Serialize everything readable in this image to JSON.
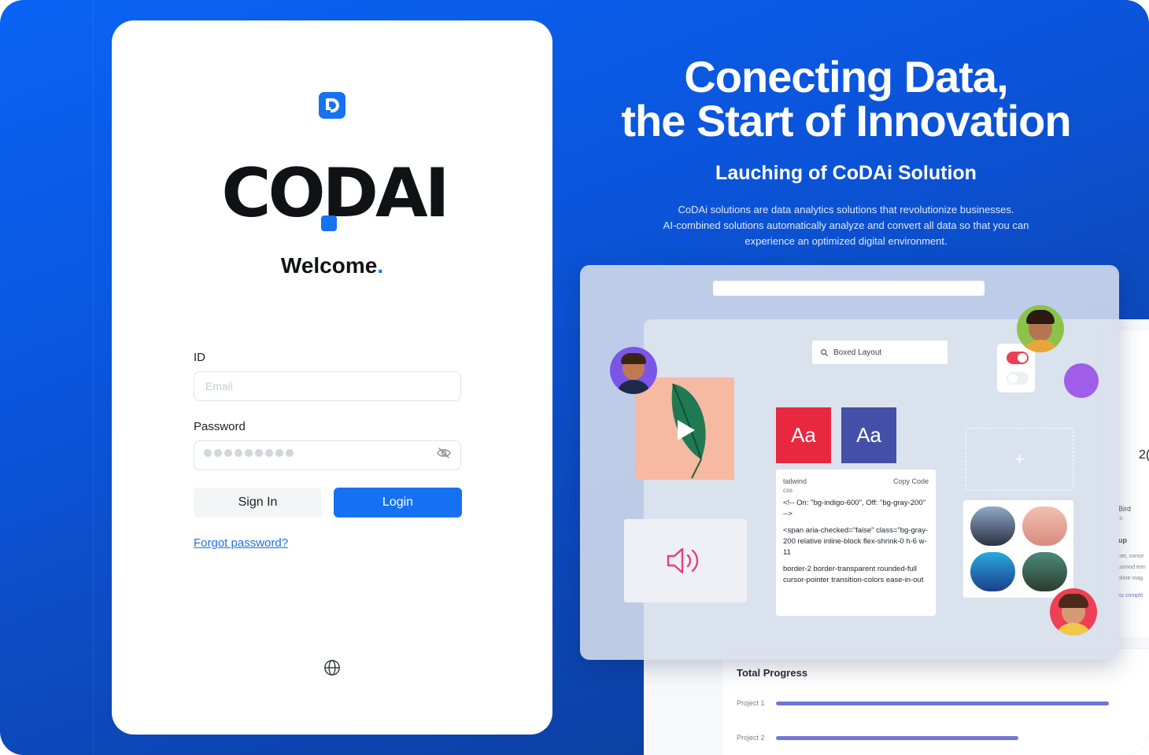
{
  "brand": {
    "wordmark": "CODAI",
    "primary_color": "#1673f0",
    "icon": "codai-logo-icon"
  },
  "login": {
    "welcome": "Welcome",
    "welcome_dot": ".",
    "id_label": "ID",
    "id_placeholder": "Email",
    "password_label": "Password",
    "password_masked": "●●●●●●●●●",
    "password_toggle_icon": "eye-off-icon",
    "signin_label": "Sign In",
    "login_label": "Login",
    "forgot_label": "Forgot password?",
    "language_icon": "globe-icon"
  },
  "hero": {
    "title_line1": "Conecting Data,",
    "title_line2": "the Start of Innovation",
    "subtitle": "Lauching of CoDAi Solution",
    "desc_line1": "CoDAi solutions are data analytics solutions that revolutionize businesses.",
    "desc_line2": "AI-combined solutions automatically analyze and convert all data so that you can",
    "desc_line3": "experience an optimized digital environment."
  },
  "mockup": {
    "search_text": "Boxed Layout",
    "aa_label": "Aa",
    "code_title": "tailwind",
    "code_sub": "css",
    "code_action": "Copy Code",
    "code_lines": [
      "<!-- On: \"bg-indigo-600\", Off: \"bg-gray-200\" -->",
      "<span aria-checked=\"false\" class=\"bg-gray-200 relative inline-block flex-shrink-0 h-6 w-11",
      "border-2 border-transparent rounded-full cursor-pointer transition-colors ease-in-out"
    ],
    "add_symbol": "+",
    "progress_title": "Total Progress",
    "projects": [
      {
        "label": "Project 1",
        "progress": 0.92
      },
      {
        "label": "Project 2",
        "progress": 0.67
      }
    ],
    "side_texts": [
      "2(",
      "Bird",
      "io",
      "up",
      "net, conse",
      "usmod tem",
      "olore mag",
      "ks comple"
    ]
  }
}
